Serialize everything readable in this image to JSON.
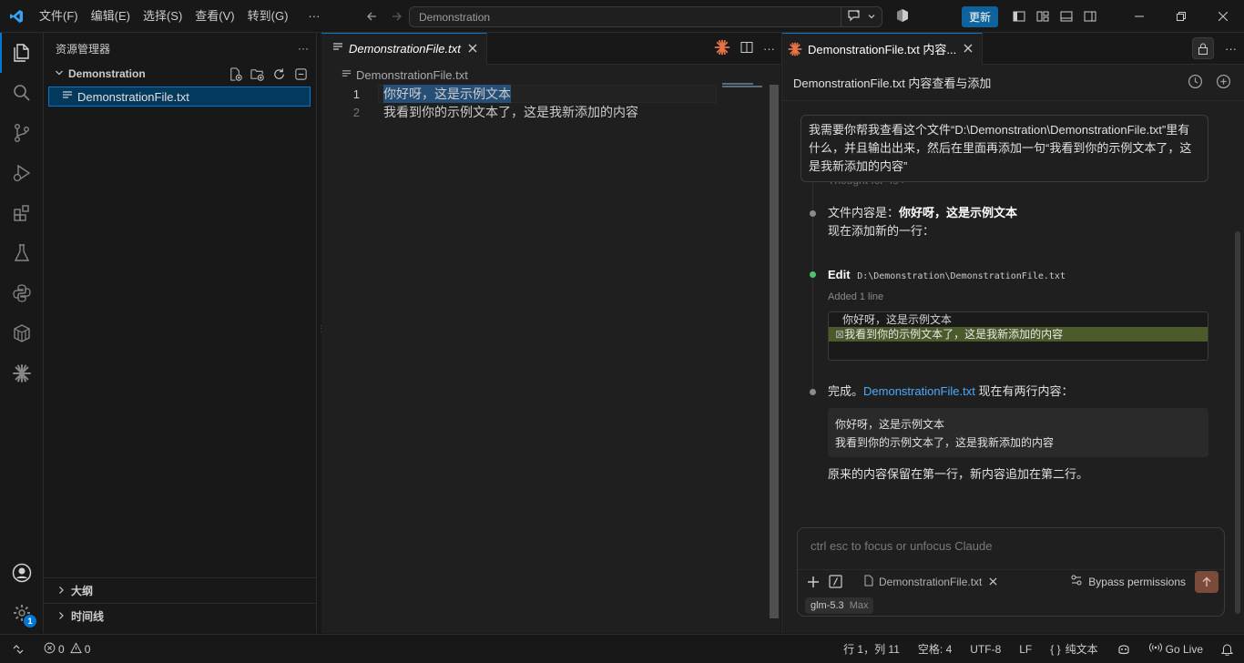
{
  "titlebar": {
    "menus": [
      "文件(F)",
      "编辑(E)",
      "选择(S)",
      "查看(V)",
      "转到(G)",
      "···"
    ],
    "search_text": "Demonstration",
    "update_label": "更新"
  },
  "sidebar": {
    "title": "资源管理器",
    "folder": "Demonstration",
    "file": "DemonstrationFile.txt",
    "outline_label": "大纲",
    "timeline_label": "时间线"
  },
  "activity": {
    "settings_badge": "1"
  },
  "editor": {
    "tab_label": "DemonstrationFile.txt",
    "breadcrumb": "DemonstrationFile.txt",
    "lines": [
      {
        "num": "1",
        "text": "你好呀，这是示例文本"
      },
      {
        "num": "2",
        "text": "我看到你的示例文本了，这是我新添加的内容"
      }
    ]
  },
  "panel": {
    "tab_label": "DemonstrationFile.txt 内容...",
    "header_title": "DemonstrationFile.txt 内容查看与添加",
    "user_message": "我需要你帮我查看这个文件“D:\\Demonstration\\DemonstrationFile.txt”里有什么，并且输出出来，然后在里面再添加一句“我看到你的示例文本了，这是我新添加的内容”",
    "thought": "Thought for 4s",
    "msg1_prefix": "文件内容是：",
    "msg1_bold": "你好呀，这是示例文本",
    "msg1_line2": "现在添加新的一行：",
    "edit_label": "Edit",
    "edit_path": "D:\\Demonstration\\DemonstrationFile.txt",
    "edit_summary": "Added 1 line",
    "diff_context": "你好呀，这是示例文本",
    "diff_added": "我看到你的示例文本了，这是我新添加的内容",
    "diff_marker": "⊠",
    "done_prefix": "完成。",
    "done_link": "DemonstrationFile.txt",
    "done_suffix": " 现在有两行内容：",
    "block_line1": "你好呀，这是示例文本",
    "block_line2": "我看到你的示例文本了，这是我新添加的内容",
    "conclusion": "原来的内容保留在第一行，新内容追加在第二行。",
    "input_placeholder": "ctrl esc to focus or unfocus Claude",
    "file_chip": "DemonstrationFile.txt",
    "bypass_label": "Bypass permissions",
    "model_name": "glm-5.3",
    "model_mode": "Max"
  },
  "statusbar": {
    "errors": "0",
    "warnings": "0",
    "position": "行 1，列 11",
    "spaces": "空格: 4",
    "encoding": "UTF-8",
    "eol": "LF",
    "language": "纯文本",
    "golive": "Go Live"
  },
  "colors": {
    "accent": "#0078d4",
    "claude_orange": "#e8734a",
    "diff_added_bg": "#4b5a2a",
    "link": "#4daafc"
  }
}
